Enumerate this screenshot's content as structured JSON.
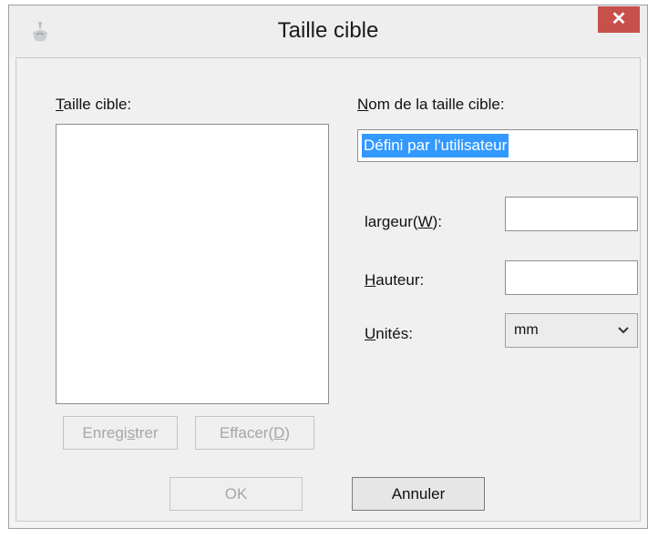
{
  "window": {
    "title": "Taille cible",
    "close_label": "✕"
  },
  "left": {
    "list_label_first": "T",
    "list_label_rest": "aille cible:",
    "save_button": {
      "pre": "Enregi",
      "key": "s",
      "post": "trer"
    },
    "delete_button": {
      "pre": "Effacer(",
      "key": "D",
      "post": ")"
    }
  },
  "right": {
    "name_label": {
      "key": "N",
      "rest": "om de la taille cible:"
    },
    "name_value": "Défini par l'utilisateur",
    "width_label": {
      "pre": "largeur(",
      "key": "W",
      "post": "):"
    },
    "width_value": "",
    "height_label": {
      "key": "H",
      "rest": "auteur:"
    },
    "height_value": "",
    "units_label": {
      "key": "U",
      "rest": "nités:"
    },
    "units_value": "mm"
  },
  "footer": {
    "ok": "OK",
    "cancel": "Annuler"
  },
  "colors": {
    "close_button": "#c7504a",
    "selection": "#3399ff"
  }
}
